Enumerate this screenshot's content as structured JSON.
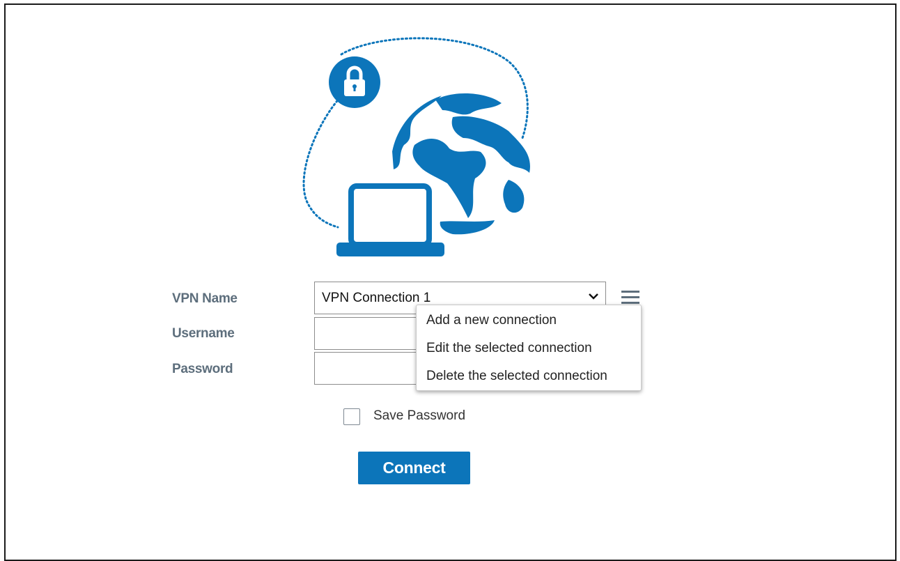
{
  "illustration": {
    "lock_icon": "lock-icon",
    "globe_icon": "globe-icon",
    "laptop_icon": "laptop-icon",
    "accent_color": "#0c75ba"
  },
  "form": {
    "vpn_name_label": "VPN Name",
    "username_label": "Username",
    "password_label": "Password",
    "vpn_selected": "VPN Connection 1",
    "username_value": "",
    "password_value": ""
  },
  "menu": {
    "icon": "hamburger-menu-icon",
    "items": [
      {
        "label": "Add a new connection"
      },
      {
        "label": "Edit the selected connection"
      },
      {
        "label": "Delete the selected connection"
      }
    ]
  },
  "save_password": {
    "label": "Save Password",
    "checked": false
  },
  "connect_button": {
    "label": "Connect",
    "color": "#0c75ba"
  }
}
